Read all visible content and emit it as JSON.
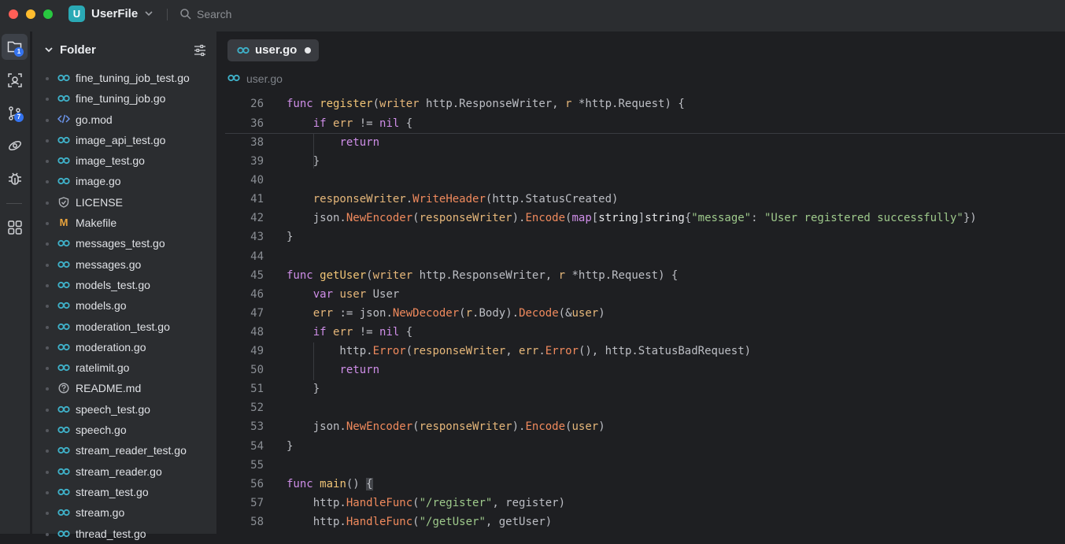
{
  "titlebar": {
    "project_initial": "U",
    "project_name": "UserFile",
    "search_label": "Search"
  },
  "activity_bar": {
    "items": [
      {
        "name": "project",
        "badge": "1"
      },
      {
        "name": "find-in-files"
      },
      {
        "name": "vcs",
        "badge": "7"
      },
      {
        "name": "services"
      },
      {
        "name": "debug"
      },
      {
        "name": "plugins"
      }
    ]
  },
  "sidebar": {
    "title": "Folder",
    "files": [
      {
        "name": "fine_tuning_job_test.go",
        "icon": "go-icon"
      },
      {
        "name": "fine_tuning_job.go",
        "icon": "go-icon"
      },
      {
        "name": "go.mod",
        "icon": "code-icon"
      },
      {
        "name": "image_api_test.go",
        "icon": "go-icon"
      },
      {
        "name": "image_test.go",
        "icon": "go-icon"
      },
      {
        "name": "image.go",
        "icon": "go-icon"
      },
      {
        "name": "LICENSE",
        "icon": "shield-icon"
      },
      {
        "name": "Makefile",
        "icon": "makefile-icon"
      },
      {
        "name": "messages_test.go",
        "icon": "go-icon"
      },
      {
        "name": "messages.go",
        "icon": "go-icon"
      },
      {
        "name": "models_test.go",
        "icon": "go-icon"
      },
      {
        "name": "models.go",
        "icon": "go-icon"
      },
      {
        "name": "moderation_test.go",
        "icon": "go-icon"
      },
      {
        "name": "moderation.go",
        "icon": "go-icon"
      },
      {
        "name": "ratelimit.go",
        "icon": "go-icon"
      },
      {
        "name": "README.md",
        "icon": "help-icon"
      },
      {
        "name": "speech_test.go",
        "icon": "go-icon"
      },
      {
        "name": "speech.go",
        "icon": "go-icon"
      },
      {
        "name": "stream_reader_test.go",
        "icon": "go-icon"
      },
      {
        "name": "stream_reader.go",
        "icon": "go-icon"
      },
      {
        "name": "stream_test.go",
        "icon": "go-icon"
      },
      {
        "name": "stream.go",
        "icon": "go-icon"
      },
      {
        "name": "thread_test.go",
        "icon": "go-icon"
      }
    ]
  },
  "editor": {
    "tab_label": "user.go",
    "breadcrumb": "user.go",
    "lines": [
      {
        "n": "26",
        "t": "func register(writer http.ResponseWriter, r *http.Request) {"
      },
      {
        "n": "36",
        "t": "    if err != nil {"
      },
      {
        "n": "38",
        "t": "        return"
      },
      {
        "n": "39",
        "t": "    }"
      },
      {
        "n": "40",
        "t": ""
      },
      {
        "n": "41",
        "t": "    responseWriter.WriteHeader(http.StatusCreated)"
      },
      {
        "n": "42",
        "t": "    json.NewEncoder(responseWriter).Encode(map[string]string{\"message\": \"User registered successfully\"})"
      },
      {
        "n": "43",
        "t": "}"
      },
      {
        "n": "44",
        "t": ""
      },
      {
        "n": "45",
        "t": "func getUser(writer http.ResponseWriter, r *http.Request) {"
      },
      {
        "n": "46",
        "t": "    var user User"
      },
      {
        "n": "47",
        "t": "    err := json.NewDecoder(r.Body).Decode(&user)"
      },
      {
        "n": "48",
        "t": "    if err != nil {"
      },
      {
        "n": "49",
        "t": "        http.Error(responseWriter, err.Error(), http.StatusBadRequest)"
      },
      {
        "n": "50",
        "t": "        return"
      },
      {
        "n": "51",
        "t": "    }"
      },
      {
        "n": "52",
        "t": ""
      },
      {
        "n": "53",
        "t": "    json.NewEncoder(responseWriter).Encode(user)"
      },
      {
        "n": "54",
        "t": "}"
      },
      {
        "n": "55",
        "t": ""
      },
      {
        "n": "56",
        "t": "func main() {"
      },
      {
        "n": "57",
        "t": "    http.HandleFunc(\"/register\", register)"
      },
      {
        "n": "58",
        "t": "    http.HandleFunc(\"/getUser\", getUser)"
      }
    ]
  },
  "colors": {
    "accent": "#3574f0",
    "project_badge": "#2aa9b5",
    "go_icon": "#3fb1c9"
  }
}
